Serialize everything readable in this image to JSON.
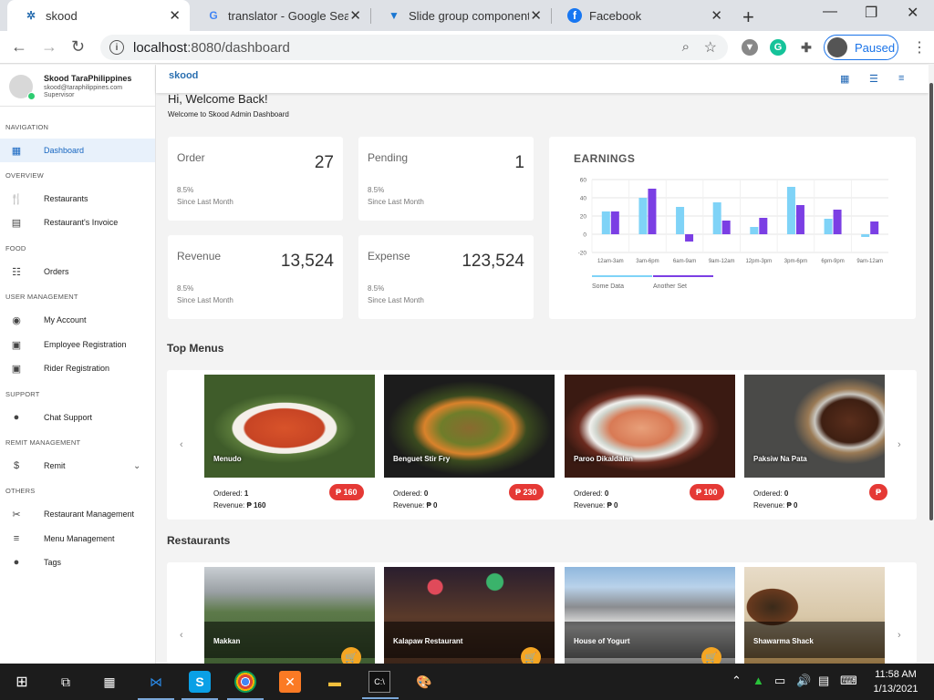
{
  "browser": {
    "tabs": [
      {
        "title": "skood",
        "active": true
      },
      {
        "title": "translator - Google Search",
        "active": false
      },
      {
        "title": "Slide group component - ",
        "active": false
      },
      {
        "title": "Facebook",
        "active": false
      }
    ],
    "url_host": "localhost",
    "url_rest": ":8080/dashboard",
    "profile_label": "Paused"
  },
  "sidebar": {
    "user": {
      "name": "Skood TaraPhilippines",
      "email": "skood@taraphilippines.com",
      "role": "Supervisor"
    },
    "sections": {
      "navigation": "NAVIGATION",
      "overview": "OVERVIEW",
      "food": "FOOD",
      "user_management": "USER MANAGEMENT",
      "support": "SUPPORT",
      "remit_management": "REMIT MANAGEMENT",
      "others": "OTHERS"
    },
    "items": {
      "dashboard": "Dashboard",
      "restaurants": "Restaurants",
      "restaurants_invoice": "Restaurant's Invoice",
      "orders": "Orders",
      "my_account": "My Account",
      "employee_registration": "Employee Registration",
      "rider_registration": "Rider Registration",
      "chat_support": "Chat Support",
      "remit": "Remit",
      "restaurant_management": "Restaurant Management",
      "menu_management": "Menu Management",
      "tags": "Tags"
    }
  },
  "header": {
    "logo": "skood"
  },
  "welcome": {
    "title": "Hi, Welcome Back!",
    "subtitle": "Welcome to Skood Admin Dashboard"
  },
  "stats": {
    "order": {
      "label": "Order",
      "value": "27",
      "pct": "8.5%",
      "since": "Since Last Month"
    },
    "pending": {
      "label": "Pending",
      "value": "1",
      "pct": "8.5%",
      "since": "Since Last Month"
    },
    "revenue": {
      "label": "Revenue",
      "value": "13,524",
      "pct": "8.5%",
      "since": "Since Last Month"
    },
    "expense": {
      "label": "Expense",
      "value": "123,524",
      "pct": "8.5%",
      "since": "Since Last Month"
    }
  },
  "chart_data": {
    "type": "bar",
    "title": "EARNINGS",
    "categories": [
      "12am-3am",
      "3am-6pm",
      "6am-9am",
      "9am-12am",
      "12pm-3pm",
      "3pm-6pm",
      "6pm-9pm",
      "9am-12am"
    ],
    "series": [
      {
        "name": "Some Data",
        "values": [
          25,
          40,
          30,
          35,
          8,
          52,
          17,
          -3
        ],
        "color": "#7fd3f7"
      },
      {
        "name": "Another Set",
        "values": [
          25,
          50,
          -8,
          15,
          18,
          32,
          27,
          14
        ],
        "color": "#7b3fe4"
      }
    ],
    "yticks": [
      60,
      40,
      20,
      0,
      -20
    ],
    "ylim": [
      -20,
      60
    ],
    "grid": true,
    "legend": "bottom-left"
  },
  "top_menus": {
    "title": "Top Menus",
    "ordered_label": "Ordered:",
    "revenue_label": "Revenue:",
    "items": [
      {
        "name": "Menudo",
        "ordered": "1",
        "revenue": "₱ 160",
        "price": "₱ 160"
      },
      {
        "name": "Benguet Stir Fry",
        "ordered": "0",
        "revenue": "₱ 0",
        "price": "₱ 230"
      },
      {
        "name": "Paroo Dikaldalan",
        "ordered": "0",
        "revenue": "₱ 0",
        "price": "₱ 100"
      },
      {
        "name": "Paksiw Na Pata",
        "ordered": "0",
        "revenue": "₱ 0",
        "price": "₱"
      }
    ]
  },
  "restaurants": {
    "title": "Restaurants",
    "items": [
      {
        "name": "Makkan"
      },
      {
        "name": "Kalapaw Restaurant"
      },
      {
        "name": "House of Yogurt"
      },
      {
        "name": "Shawarma Shack"
      }
    ]
  },
  "taskbar": {
    "time": "11:58 AM",
    "date": "1/13/2021"
  }
}
